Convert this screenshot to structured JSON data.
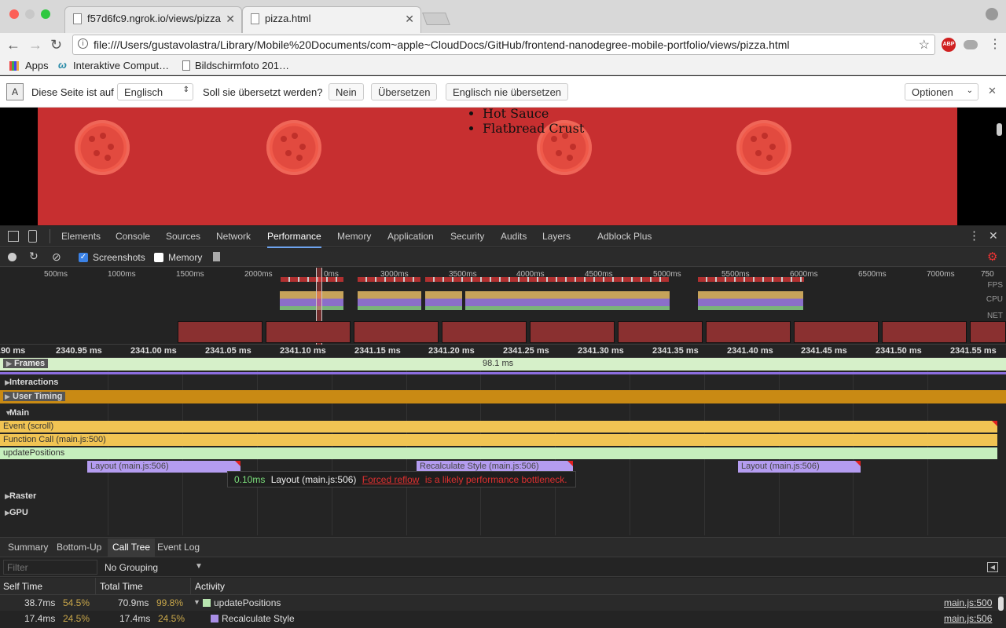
{
  "browser": {
    "tabs": [
      {
        "title": "f57d6fc9.ngrok.io/views/pizza"
      },
      {
        "title": "pizza.html"
      }
    ],
    "url": "file:///Users/gustavolastra/Library/Mobile%20Documents/com~apple~CloudDocs/GitHub/frontend-nanodegree-mobile-portfolio/views/pizza.html",
    "bookmarks": [
      "Apps",
      "Interaktive Comput…",
      "Bildschirmfoto 201…"
    ],
    "extension_label": "ABP"
  },
  "translate_bar": {
    "prefix": "Diese Seite ist auf",
    "language": "Englisch",
    "question": "Soll sie übersetzt werden?",
    "no": "Nein",
    "translate": "Übersetzen",
    "never": "Englisch nie übersetzen",
    "options": "Optionen"
  },
  "page": {
    "list_items": [
      "Hot Sauce",
      "Flatbread Crust"
    ]
  },
  "devtools": {
    "tabs": [
      "Elements",
      "Console",
      "Sources",
      "Network",
      "Performance",
      "Memory",
      "Application",
      "Security",
      "Audits",
      "Layers",
      "Adblock Plus"
    ],
    "active_tab": "Performance",
    "toolbar": {
      "screenshots": "Screenshots",
      "memory": "Memory"
    },
    "overview_ticks": [
      "500ms",
      "1000ms",
      "1500ms",
      "2000ms",
      "0ms",
      "3000ms",
      "3500ms",
      "4000ms",
      "4500ms",
      "5000ms",
      "5500ms",
      "6000ms",
      "6500ms",
      "7000ms",
      "750"
    ],
    "overview_labels": [
      "FPS",
      "CPU",
      "NET"
    ],
    "ruler_ticks": [
      ".90 ms",
      "2340.95 ms",
      "2341.00 ms",
      "2341.05 ms",
      "2341.10 ms",
      "2341.15 ms",
      "2341.20 ms",
      "2341.25 ms",
      "2341.30 ms",
      "2341.35 ms",
      "2341.40 ms",
      "2341.45 ms",
      "2341.50 ms",
      "2341.55 ms"
    ],
    "tracks": {
      "frames": "Frames",
      "frame_duration": "98.1 ms",
      "interactions": "Interactions",
      "user_timing": "User Timing",
      "main": "Main",
      "raster": "Raster",
      "gpu": "GPU"
    },
    "flame": {
      "event": "Event (scroll)",
      "function_call": "Function Call (main.js:500)",
      "update": "updatePositions",
      "layout1": "Layout (main.js:506)",
      "recalc": "Recalculate Style (main.js:506)",
      "layout2": "Layout (main.js:506)"
    },
    "tooltip": {
      "time": "0.10ms",
      "name": "Layout (main.js:506)",
      "link": "Forced reflow",
      "warning": "is a likely performance bottleneck."
    },
    "bottom_tabs": [
      "Summary",
      "Bottom-Up",
      "Call Tree",
      "Event Log"
    ],
    "active_bottom_tab": "Call Tree",
    "filter_placeholder": "Filter",
    "grouping": "No Grouping",
    "table": {
      "headers": [
        "Self Time",
        "Total Time",
        "Activity"
      ],
      "rows": [
        {
          "self": "38.7ms",
          "self_pct": "54.5%",
          "total": "70.9ms",
          "total_pct": "99.8%",
          "activity": "updatePositions",
          "source": "main.js:500",
          "color": "#b9e6b0"
        },
        {
          "self": "17.4ms",
          "self_pct": "24.5%",
          "total": "17.4ms",
          "total_pct": "24.5%",
          "activity": "Recalculate Style",
          "source": "main.js:506",
          "color": "#a98ee6"
        }
      ]
    }
  }
}
